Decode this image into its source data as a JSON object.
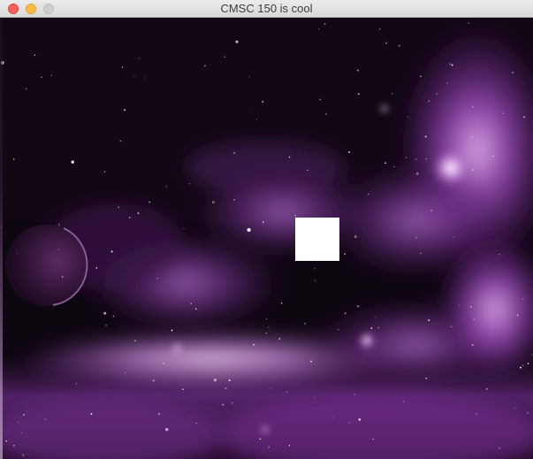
{
  "window": {
    "title": "CMSC 150 is cool",
    "controls": {
      "close_color": "#fc605c",
      "minimize_color": "#fdbc40",
      "zoom_color": "#cfcfcf"
    }
  },
  "scene": {
    "background": "space-nebula-image",
    "palette": {
      "sky": "#0d070f",
      "nebula_dark": "#3b1646",
      "nebula_mid": "#8a3fa8",
      "nebula_bright": "#d89ce8",
      "highlight": "#f6dcff",
      "planet": "#3a1b3f"
    },
    "sprite": {
      "shape": "square",
      "color": "#ffffff"
    }
  }
}
